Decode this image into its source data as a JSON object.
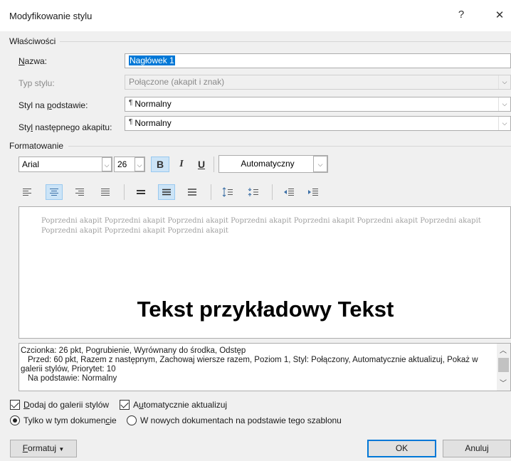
{
  "window": {
    "title": "Modyfikowanie stylu",
    "help": "?",
    "close": "✕"
  },
  "properties": {
    "group_label": "Właściwości",
    "name": {
      "label": "Nazwa:",
      "value": "Nagłówek 1"
    },
    "style_type": {
      "label": "Typ stylu:",
      "value": "Połączone (akapit i znak)"
    },
    "based_on": {
      "label": "Styl na podstawie:",
      "value": "Normalny"
    },
    "next_style": {
      "label": "Styl następnego akapitu:",
      "value": "Normalny"
    }
  },
  "formatting": {
    "group_label": "Formatowanie",
    "font": "Arial",
    "size": "26",
    "bold": "B",
    "italic": "I",
    "underline": "U",
    "color": "Automatyczny"
  },
  "preview": {
    "previous_paragraph": "Poprzedni akapit Poprzedni akapit Poprzedni akapit Poprzedni akapit Poprzedni akapit Poprzedni akapit Poprzedni akapit Poprzedni akapit Poprzedni akapit Poprzedni akapit",
    "sample_text": "Tekst przykładowy Tekst"
  },
  "description": {
    "line1": "Czcionka: 26 pkt, Pogrubienie, Wyrównany do środka, Odstęp",
    "line2": "Przed:  60 pkt, Razem z następnym, Zachowaj wiersze razem, Poziom 1, Styl: Połączony, Automatycznie aktualizuj, Pokaż w galerii stylów, Priorytet: 10",
    "line3": "Na podstawie: Normalny"
  },
  "options": {
    "add_to_gallery": "Dodaj do galerii stylów",
    "auto_update": "Automatycznie aktualizuj",
    "only_this_document": "Tylko w tym dokumencie",
    "new_documents": "W nowych dokumentach na podstawie tego szablonu"
  },
  "buttons": {
    "format": "Formatuj",
    "ok": "OK",
    "cancel": "Anuluj"
  },
  "colors": {
    "accent": "#0078d7",
    "active_toggle": "#cce4f7"
  }
}
